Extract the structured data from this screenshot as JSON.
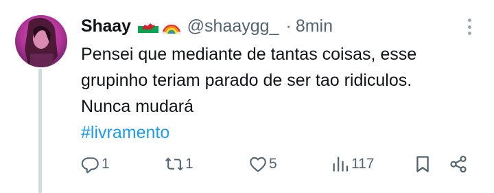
{
  "tweet": {
    "author_name": "Shaay",
    "handle": "@shaaygg_",
    "separator": "·",
    "time": "8min",
    "flags": [
      "wales-flag",
      "rainbow"
    ],
    "text_lines": [
      "Pensei que mediante de tantas coisas, esse",
      "grupinho teriam parado de ser tao ridiculos.",
      "Nunca mudará"
    ],
    "hashtag": "#livramento"
  },
  "actions": {
    "reply": {
      "icon": "reply-icon",
      "count": "1"
    },
    "retweet": {
      "icon": "retweet-icon",
      "count": "1"
    },
    "like": {
      "icon": "heart-icon",
      "count": "5"
    },
    "views": {
      "icon": "views-icon",
      "count": "117"
    },
    "bookmark": {
      "icon": "bookmark-icon"
    },
    "share": {
      "icon": "share-icon"
    }
  },
  "colors": {
    "text": "#0f1419",
    "secondary": "#536471",
    "link": "#1d9bf0",
    "thread_line": "#cfd9de"
  }
}
